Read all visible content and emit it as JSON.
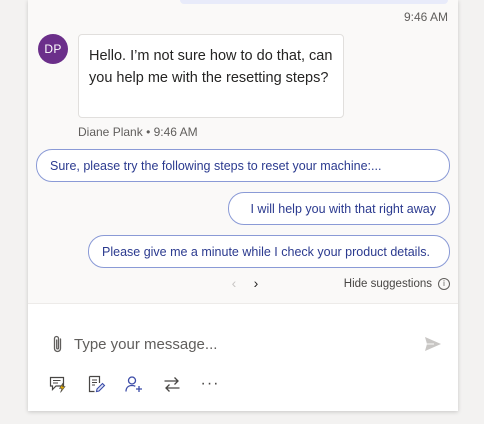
{
  "conversation": {
    "previous_message_time": "9:46 AM",
    "incoming_message": {
      "avatar_initials": "DP",
      "text": "Hello. I’m not sure how to do that, can you help me with the resetting steps?",
      "sender": "Diane Plank",
      "time": "9:46 AM"
    }
  },
  "suggestions": {
    "items": [
      {
        "label": "Sure, please try the following steps to reset your machine:..."
      },
      {
        "label": "I will help you with that right away"
      },
      {
        "label": "Please give me a minute while I check your product details."
      }
    ],
    "hide_label": "Hide suggestions"
  },
  "composer": {
    "placeholder": "Type your message...",
    "toolbar_icons": [
      "quick-replies-icon",
      "notes-icon",
      "consult-icon",
      "transfer-icon",
      "more-icon"
    ]
  },
  "colors": {
    "avatar_bg": "#6b2f8a",
    "suggestion_border": "#8a9ad6",
    "suggestion_text": "#2b3a8f",
    "accent": "#3b4ba7"
  }
}
